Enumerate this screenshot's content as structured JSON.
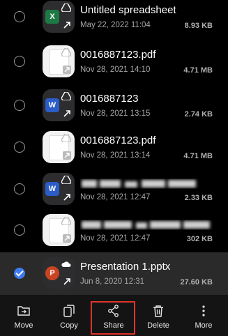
{
  "files": [
    {
      "name": "Untitled spreadsheet",
      "date": "May 22, 2022 11:04",
      "size": "8.93 KB",
      "icon": "excel-icon",
      "selected": false
    },
    {
      "name": "0016887123.pdf",
      "date": "Nov 28, 2021 14:10",
      "size": "4.71 MB",
      "icon": "pdf-thumbnail",
      "selected": false
    },
    {
      "name": "0016887123",
      "date": "Nov 28, 2021 13:15",
      "size": "2.74 KB",
      "icon": "word-icon",
      "selected": false
    },
    {
      "name": "0016887123.pdf",
      "date": "Nov 28, 2021 13:14",
      "size": "4.71 MB",
      "icon": "pdf-thumbnail",
      "selected": false
    },
    {
      "name": "",
      "date": "Nov 28, 2021 12:47",
      "size": "2.33 KB",
      "icon": "word-icon",
      "selected": false
    },
    {
      "name": "",
      "date": "Nov 28, 2021 12:47",
      "size": "302 KB",
      "icon": "pdf-thumbnail",
      "selected": false
    },
    {
      "name": "Presentation 1.pptx",
      "date": "Jun 8, 2020 12:31",
      "size": "27.60 KB",
      "icon": "powerpoint-icon",
      "selected": true
    }
  ],
  "toolbar": {
    "move": "Move",
    "copy": "Copy",
    "share": "Share",
    "delete": "Delete",
    "more": "More"
  },
  "colors": {
    "background": "#000000",
    "selected_row": "#2a2a2a",
    "check_accent": "#3e7bf2",
    "share_highlight": "#e0342b"
  }
}
